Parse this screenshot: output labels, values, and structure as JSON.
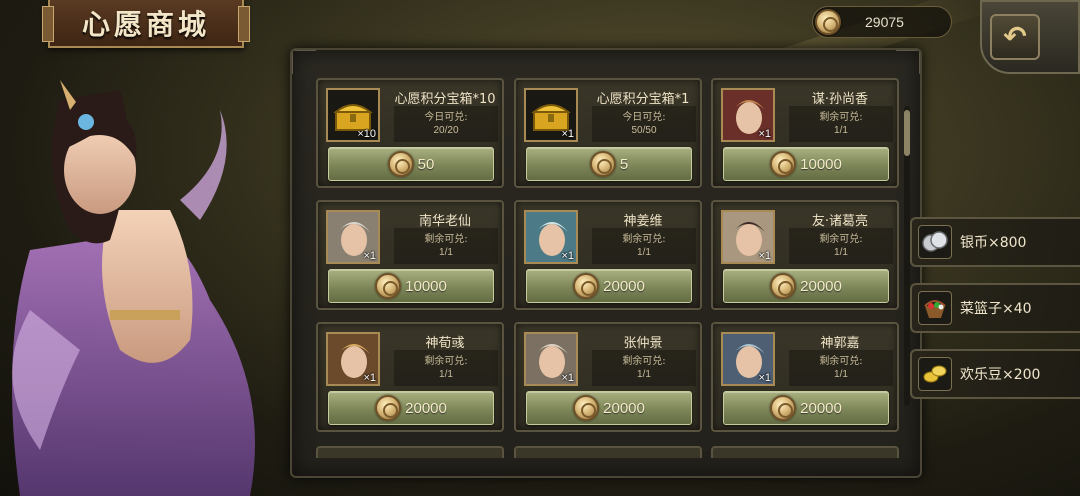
{
  "header": {
    "title": "心愿商城",
    "currency_value": "29075",
    "currency_icon": "coin-icon",
    "back_icon": "back-arrow-icon"
  },
  "shop": {
    "items": [
      {
        "name": "心愿积分宝箱*10",
        "sub_label": "今日可兑:",
        "sub_value": "20/20",
        "qty": "×10",
        "price": "50",
        "thumb": "gold-chest-icon"
      },
      {
        "name": "心愿积分宝箱*1",
        "sub_label": "今日可兑:",
        "sub_value": "50/50",
        "qty": "×1",
        "price": "5",
        "thumb": "gold-chest-icon"
      },
      {
        "name": "谋·孙尚香",
        "sub_label": "剩余可兑:",
        "sub_value": "1/1",
        "qty": "×1",
        "price": "10000",
        "thumb": "hero-portrait"
      },
      {
        "name": "南华老仙",
        "sub_label": "剩余可兑:",
        "sub_value": "1/1",
        "qty": "×1",
        "price": "10000",
        "thumb": "hero-portrait"
      },
      {
        "name": "神姜维",
        "sub_label": "剩余可兑:",
        "sub_value": "1/1",
        "qty": "×1",
        "price": "20000",
        "thumb": "hero-portrait"
      },
      {
        "name": "友·诸葛亮",
        "sub_label": "剩余可兑:",
        "sub_value": "1/1",
        "qty": "×1",
        "price": "20000",
        "thumb": "hero-portrait"
      },
      {
        "name": "神荀彧",
        "sub_label": "剩余可兑:",
        "sub_value": "1/1",
        "qty": "×1",
        "price": "20000",
        "thumb": "hero-portrait"
      },
      {
        "name": "张仲景",
        "sub_label": "剩余可兑:",
        "sub_value": "1/1",
        "qty": "×1",
        "price": "20000",
        "thumb": "hero-portrait"
      },
      {
        "name": "神郭嘉",
        "sub_label": "剩余可兑:",
        "sub_value": "1/1",
        "qty": "×1",
        "price": "20000",
        "thumb": "hero-portrait"
      }
    ]
  },
  "resources": [
    {
      "label": "银币×800",
      "icon": "silver-coin-icon"
    },
    {
      "label": "菜篮子×40",
      "icon": "vegetable-basket-icon"
    },
    {
      "label": "欢乐豆×200",
      "icon": "gold-bean-icon"
    }
  ],
  "colors": {
    "accent_gold": "#d8b878",
    "button_green": "#7d8658",
    "panel_bg": "#2a2821"
  }
}
